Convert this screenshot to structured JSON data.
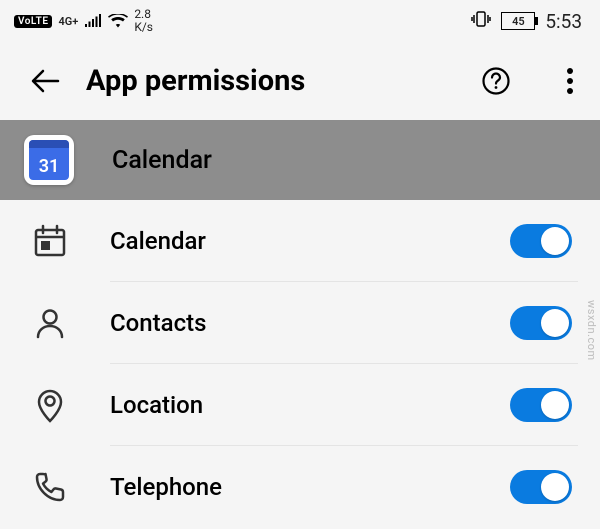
{
  "status_bar": {
    "volte": "VoLTE",
    "network_gen": "4G+",
    "data_rate": "2.8",
    "data_unit": "K/s",
    "battery": "45",
    "time": "5:53"
  },
  "app_bar": {
    "title": "App permissions"
  },
  "app_section": {
    "name": "Calendar",
    "icon_day": "31"
  },
  "permissions": [
    {
      "label": "Calendar",
      "enabled": true
    },
    {
      "label": "Contacts",
      "enabled": true
    },
    {
      "label": "Location",
      "enabled": true
    },
    {
      "label": "Telephone",
      "enabled": true
    }
  ],
  "watermark": "wsxdn.com"
}
